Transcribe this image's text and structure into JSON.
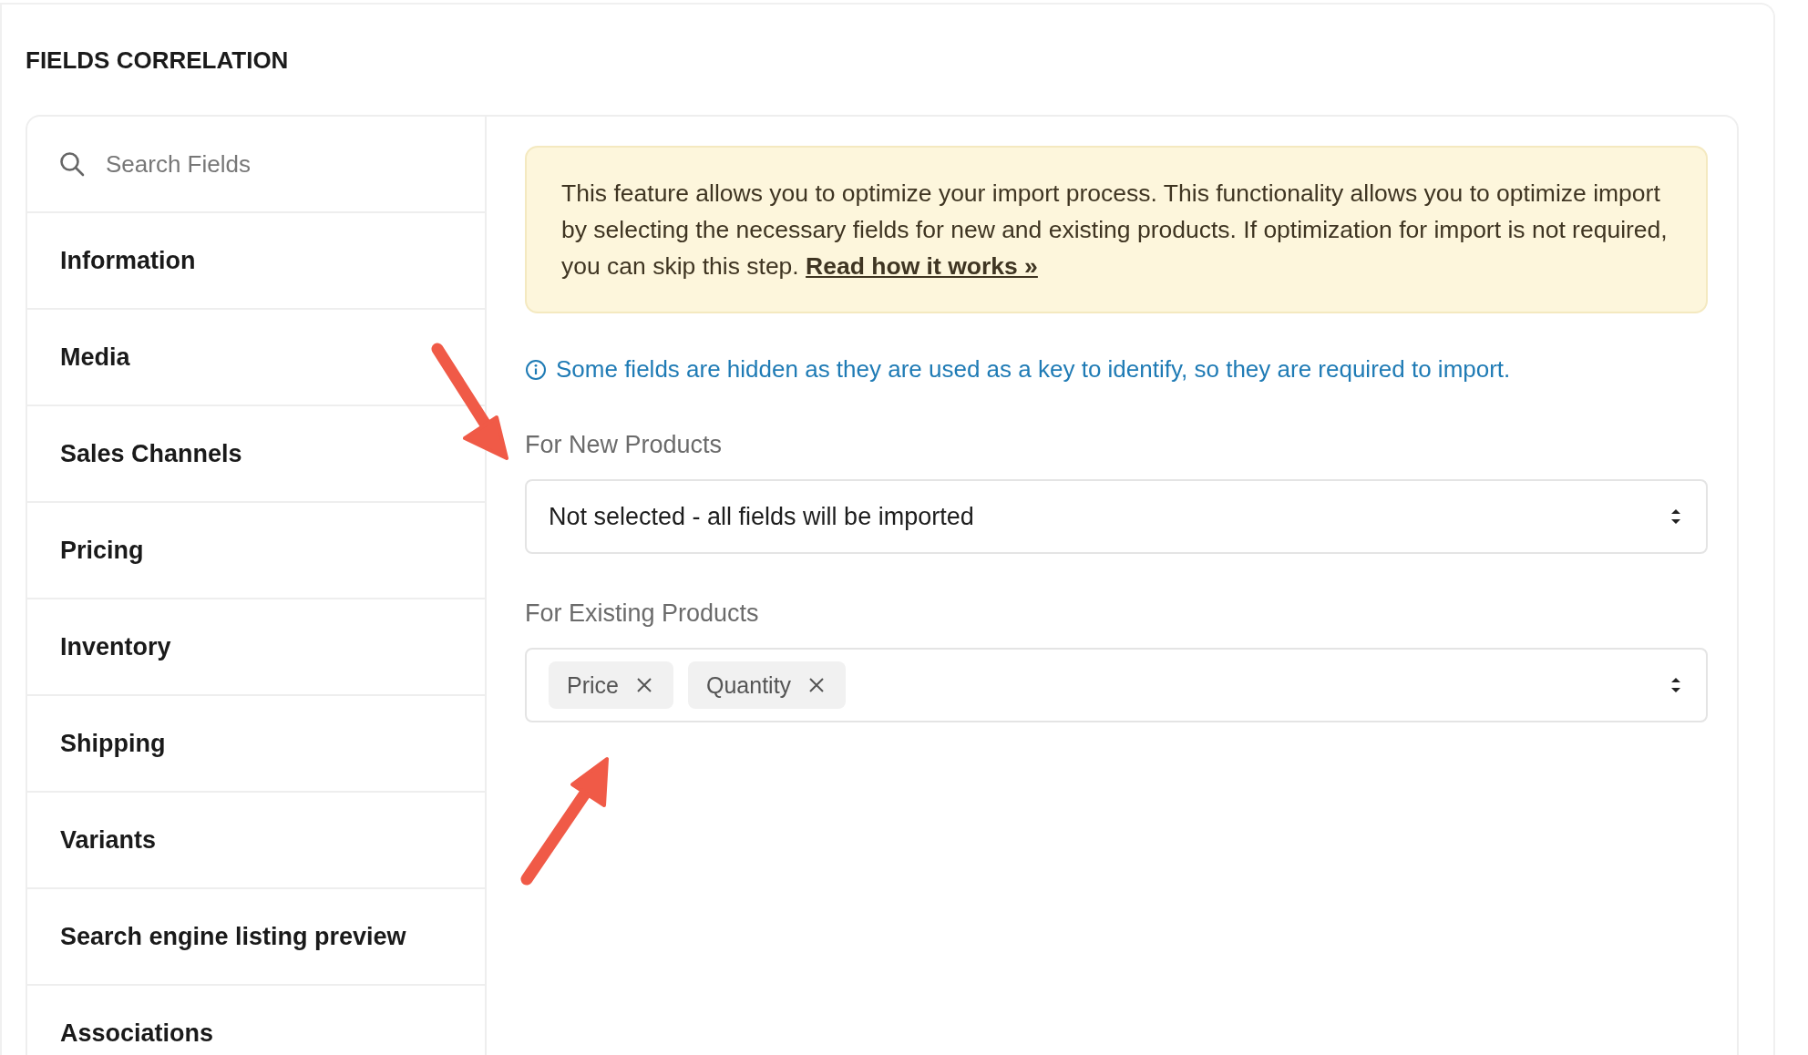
{
  "title": "FIELDS CORRELATION",
  "search": {
    "placeholder": "Search Fields"
  },
  "sections": [
    {
      "label": "Information"
    },
    {
      "label": "Media"
    },
    {
      "label": "Sales Channels"
    },
    {
      "label": "Pricing"
    },
    {
      "label": "Inventory"
    },
    {
      "label": "Shipping"
    },
    {
      "label": "Variants"
    },
    {
      "label": "Search engine listing preview"
    },
    {
      "label": "Associations"
    }
  ],
  "notice": {
    "text": "This feature allows you to optimize your import process. This functionality allows you to optimize import by selecting the necessary fields for new and existing products. If optimization for import is not required, you can skip this step.",
    "link": "Read how it works »"
  },
  "info": "Some fields are hidden as they are used as a key to identify, so they are required to import.",
  "new_products": {
    "label": "For New Products",
    "value": "Not selected - all fields will be imported"
  },
  "existing_products": {
    "label": "For Existing Products",
    "tags": [
      "Price",
      "Quantity"
    ]
  }
}
